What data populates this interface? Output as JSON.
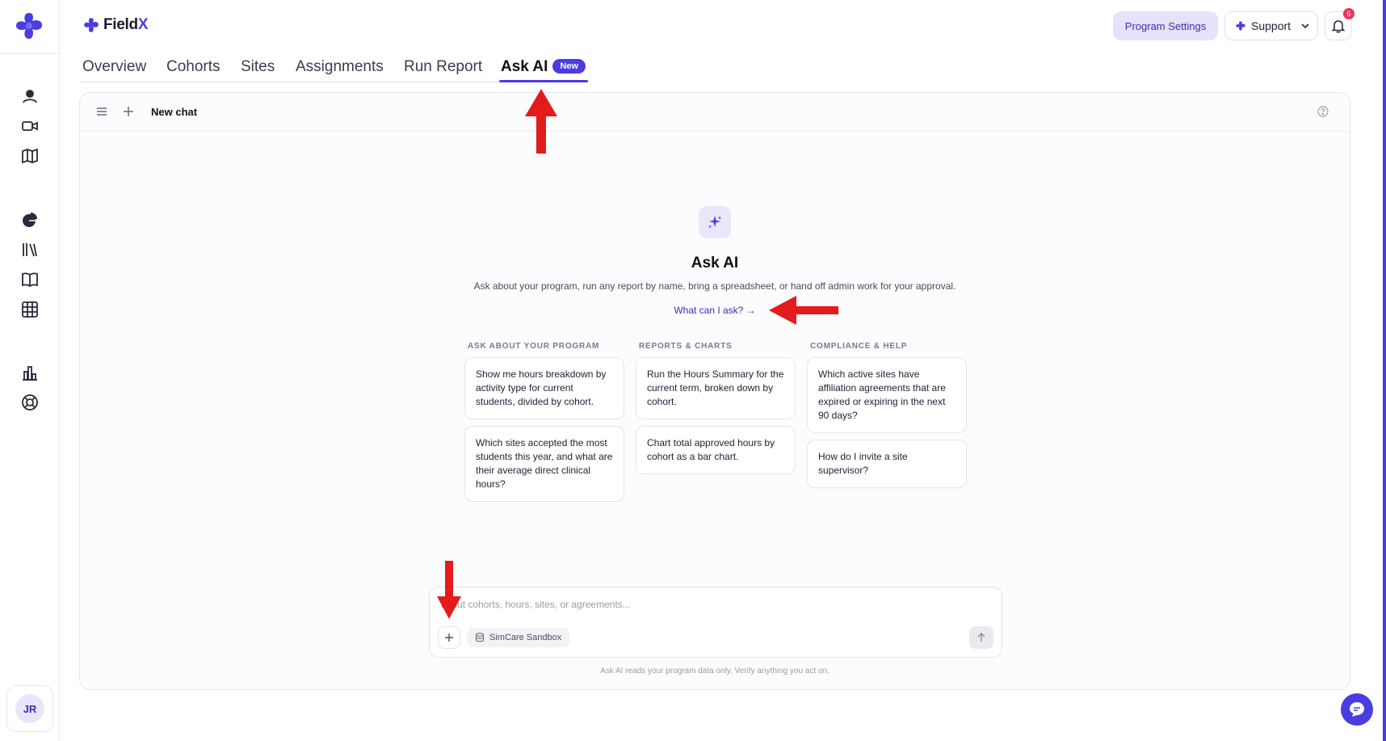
{
  "brand": {
    "name_prefix": "Field",
    "name_suffix": "X"
  },
  "header": {
    "program_settings_label": "Program Settings",
    "support_label": "Support",
    "notification_count": "6"
  },
  "tabs": [
    {
      "label": "Overview"
    },
    {
      "label": "Cohorts"
    },
    {
      "label": "Sites"
    },
    {
      "label": "Assignments"
    },
    {
      "label": "Run Report"
    },
    {
      "label": "Ask AI",
      "badge": "New",
      "active": true
    }
  ],
  "sidebar": {
    "items": [
      {
        "icon": "user-circle-icon"
      },
      {
        "icon": "video-icon"
      },
      {
        "icon": "map-icon"
      },
      {
        "icon": "pie-chart-icon"
      },
      {
        "icon": "library-icon"
      },
      {
        "icon": "book-icon"
      },
      {
        "icon": "grid-icon"
      },
      {
        "icon": "bar-chart-icon"
      },
      {
        "icon": "life-buoy-icon"
      }
    ],
    "avatar_initials": "JR"
  },
  "chat": {
    "title": "New chat",
    "hero_title": "Ask AI",
    "hero_subtitle": "Ask about your program, run any report by name, bring a spreadsheet, or hand off admin work for your approval.",
    "what_can_i_ask": "What can I ask? →",
    "columns": [
      {
        "heading": "ASK ABOUT YOUR PROGRAM",
        "cards": [
          "Show me hours breakdown by activity type for current students, divided by cohort.",
          "Which sites accepted the most students this year, and what are their average direct clinical hours?"
        ]
      },
      {
        "heading": "REPORTS & CHARTS",
        "cards": [
          "Run the Hours Summary for the current term, broken down by cohort.",
          "Chart total approved hours by cohort as a bar chart."
        ]
      },
      {
        "heading": "COMPLIANCE & HELP",
        "cards": [
          "Which active sites have affiliation agreements that are expired or expiring in the next 90 days?",
          "How do I invite a site supervisor?"
        ]
      }
    ],
    "composer_placeholder": "about cohorts, hours, sites, or agreements...",
    "context_chip": "SimCare Sandbox",
    "footer_note": "Ask AI reads your program data only. Verify anything you act on."
  },
  "colors": {
    "accent": "#4b3ce0",
    "annotation_arrow": "#e31b1b"
  }
}
